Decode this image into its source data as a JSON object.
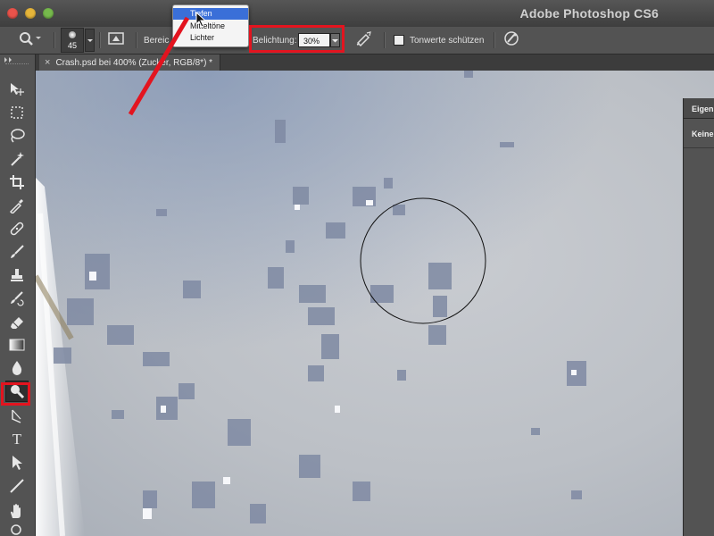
{
  "app": {
    "title": "Adobe Photoshop CS6",
    "window_buttons": [
      "close",
      "minimize",
      "zoom"
    ],
    "window_button_colors": [
      "#e9534b",
      "#e6b53a",
      "#76b94c"
    ]
  },
  "options_bar": {
    "tool_icon": "dodge-burn-magnifier-icon",
    "brush_size": "45",
    "range_label": "Bereic",
    "range_options": [
      "Tiefen",
      "Mitteltöne",
      "Lichter"
    ],
    "range_selected": "Tiefen",
    "exposure_label": "Belichtung:",
    "exposure_value": "30%",
    "exposure_dropdown_icon": "dropdown-arrow-icon",
    "airbrush_icon": "airbrush-icon",
    "protect_tones_label": "Tonwerte schützen",
    "protect_tones_checked": false,
    "pressure_icon": "pressure-size-icon"
  },
  "document_tab": {
    "close_glyph": "×",
    "title": "Crash.psd bei 400% (Zucker, RGB/8*) *"
  },
  "dropdown_menu": {
    "items": [
      {
        "label": "Tiefen",
        "selected": true
      },
      {
        "label": "Mitteltöne",
        "selected": false
      },
      {
        "label": "Lichter",
        "selected": false
      }
    ]
  },
  "tools": [
    {
      "name": "move-tool",
      "icon": "move-icon"
    },
    {
      "name": "marquee-tool",
      "icon": "marquee-icon"
    },
    {
      "name": "lasso-tool",
      "icon": "lasso-icon"
    },
    {
      "name": "magic-wand-tool",
      "icon": "magic-wand-icon"
    },
    {
      "name": "crop-tool",
      "icon": "crop-icon"
    },
    {
      "name": "eyedropper-tool",
      "icon": "eyedropper-icon"
    },
    {
      "name": "healing-brush-tool",
      "icon": "bandage-icon"
    },
    {
      "name": "brush-tool",
      "icon": "brush-icon"
    },
    {
      "name": "clone-stamp-tool",
      "icon": "stamp-icon"
    },
    {
      "name": "history-brush-tool",
      "icon": "history-brush-icon"
    },
    {
      "name": "eraser-tool",
      "icon": "eraser-icon"
    },
    {
      "name": "gradient-tool",
      "icon": "gradient-icon"
    },
    {
      "name": "blur-tool",
      "icon": "drop-icon"
    },
    {
      "name": "dodge-burn-tool",
      "icon": "dodge-icon",
      "active": true
    },
    {
      "name": "pen-tool",
      "icon": "pen-icon"
    },
    {
      "name": "type-tool",
      "icon": "type-icon",
      "glyph": "T"
    },
    {
      "name": "path-selection-tool",
      "icon": "arrow-icon"
    },
    {
      "name": "line-tool",
      "icon": "line-icon"
    },
    {
      "name": "hand-tool",
      "icon": "hand-icon"
    }
  ],
  "side_panel": {
    "header_label": "Eigens",
    "content_label": "Keine"
  },
  "annotations": {
    "highlight_color": "#e3141f"
  }
}
